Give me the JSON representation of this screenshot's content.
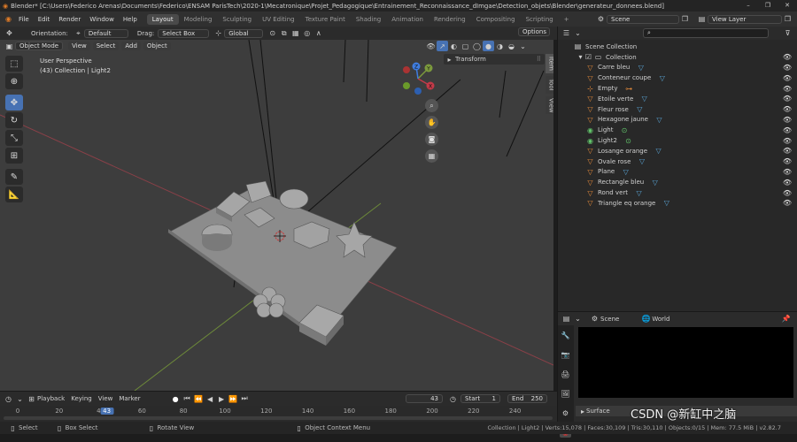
{
  "title_bar": {
    "app": "Blender*",
    "path": "[C:\\Users\\Federico Arenas\\Documents\\Federico\\ENSAM ParisTech\\2020-1\\Mecatronique\\Projet_Pedagogique\\Entrainement_Reconnaissance_dImgae\\Detection_objets\\Blender\\generateur_donnees.blend]",
    "minimize": "–",
    "maximize": "❐",
    "close": "✕"
  },
  "menu": [
    "File",
    "Edit",
    "Render",
    "Window",
    "Help"
  ],
  "workspaces": [
    "Layout",
    "Modeling",
    "Sculpting",
    "UV Editing",
    "Texture Paint",
    "Shading",
    "Animation",
    "Rendering",
    "Compositing",
    "Scripting",
    "+"
  ],
  "scene_selector": "Scene",
  "view_layer_selector": "View Layer",
  "tool_header": {
    "orientation_label": "Orientation:",
    "orientation_value": "Default",
    "drag_label": "Drag:",
    "drag_value": "Select Box",
    "transform_space": "Global",
    "options": "Options"
  },
  "viewport_header": {
    "mode": "Object Mode",
    "menus": [
      "View",
      "Select",
      "Add",
      "Object"
    ]
  },
  "viewport": {
    "perspective_label": "User Perspective",
    "collection_label": "(43) Collection | Light2",
    "n_panel_header": "Transform",
    "side_tabs": [
      "Item",
      "Tool",
      "View"
    ],
    "gizmo_axes": {
      "x": "X",
      "y": "Y",
      "z": "Z"
    }
  },
  "outliner": {
    "search_placeholder": "",
    "root": "Scene Collection",
    "collection": "Collection",
    "items": [
      {
        "label": "Carre bleu",
        "type": "mesh"
      },
      {
        "label": "Conteneur coupe",
        "type": "mesh"
      },
      {
        "label": "Empty",
        "type": "empty"
      },
      {
        "label": "Etoile verte",
        "type": "mesh"
      },
      {
        "label": "Fleur rose",
        "type": "mesh"
      },
      {
        "label": "Hexagone jaune",
        "type": "mesh"
      },
      {
        "label": "Light",
        "type": "light"
      },
      {
        "label": "Light2",
        "type": "light"
      },
      {
        "label": "Losange orange",
        "type": "mesh"
      },
      {
        "label": "Ovale rose",
        "type": "mesh"
      },
      {
        "label": "Plane",
        "type": "mesh"
      },
      {
        "label": "Rectangle bleu",
        "type": "mesh"
      },
      {
        "label": "Rond vert",
        "type": "mesh"
      },
      {
        "label": "Triangle eq orange",
        "type": "mesh"
      }
    ]
  },
  "properties": {
    "scene_tab": "Scene",
    "world_tab": "World",
    "surface_panel": "Surface"
  },
  "timeline": {
    "menus": [
      "Playback",
      "Keying",
      "View",
      "Marker"
    ],
    "current_frame": "43",
    "start_label": "Start",
    "start_value": "1",
    "end_label": "End",
    "end_value": "250",
    "ruler": [
      "0",
      "20",
      "40",
      "60",
      "80",
      "100",
      "120",
      "140",
      "160",
      "180",
      "200",
      "220",
      "240"
    ]
  },
  "status_bar": {
    "select": "Select",
    "box_select": "Box Select",
    "rotate_view": "Rotate View",
    "context_menu": "Object Context Menu",
    "stats": "Collection | Light2 | Verts:15,078 | Faces:30,109 | Tris:30,110 | Objects:0/15 | Mem: 77.5 MiB | v2.82.7"
  },
  "watermark": "CSDN @新缸中之脑",
  "colors": {
    "accent": "#4772b3",
    "x_axis": "#a33a45",
    "y_axis": "#7c9a3d",
    "z_axis": "#3f7de0",
    "mesh_icon": "#e48a3a",
    "light_icon": "#62c46a"
  }
}
